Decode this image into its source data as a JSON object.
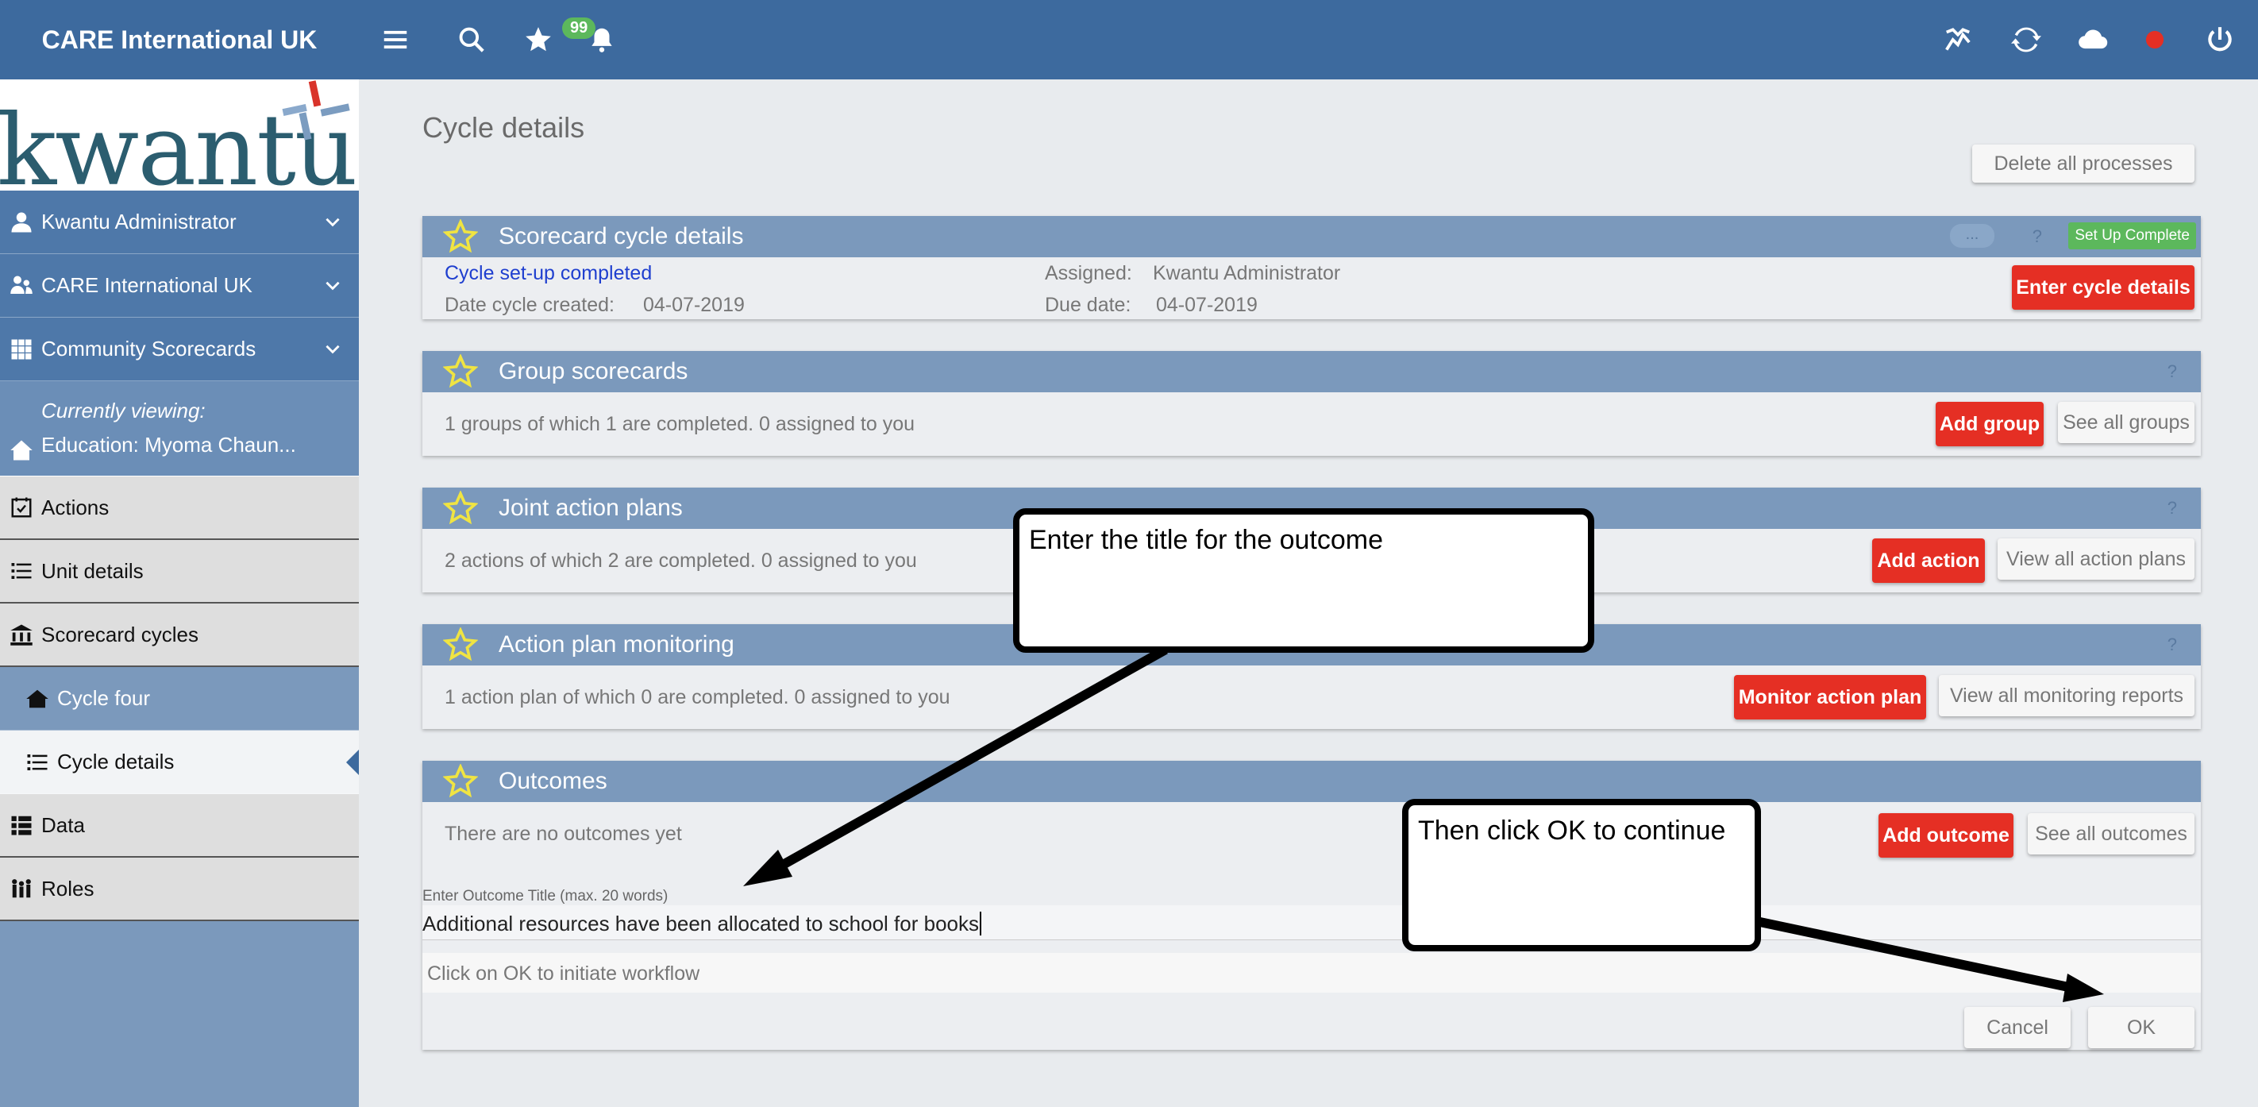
{
  "header": {
    "app_title": "CARE International UK",
    "notification_count": "99",
    "icons": [
      "menu-icon",
      "search-icon",
      "star-icon",
      "bell-icon",
      "chart-icon",
      "sync-icon",
      "cloud-icon",
      "record-icon",
      "power-icon"
    ]
  },
  "sidebar": {
    "logo_text": "kwantu",
    "items": [
      {
        "label": "Kwantu Administrator",
        "icon": "user-icon"
      },
      {
        "label": "CARE International UK",
        "icon": "org-icon"
      },
      {
        "label": "Community Scorecards",
        "icon": "grid-icon"
      }
    ],
    "viewing_label": "Currently viewing:",
    "viewing_value": "Education: Myoma Chaun...",
    "nav": [
      {
        "label": "Actions",
        "icon": "calendar-check-icon"
      },
      {
        "label": "Unit details",
        "icon": "list-icon"
      },
      {
        "label": "Scorecard cycles",
        "icon": "building-icon"
      },
      {
        "label": "Cycle four",
        "icon": "building-icon"
      },
      {
        "label": "Cycle details",
        "icon": "list-icon"
      },
      {
        "label": "Data",
        "icon": "list-icon"
      },
      {
        "label": "Roles",
        "icon": "people-icon"
      }
    ]
  },
  "main": {
    "page_title": "Cycle details",
    "delete_all_label": "Delete all processes",
    "scorecard": {
      "title": "Scorecard cycle details",
      "more": "...",
      "help": "?",
      "status_badge": "Set Up Complete",
      "status_link": "Cycle set-up completed",
      "date_label": "Date cycle created:",
      "date_value": "04-07-2019",
      "assigned_label": "Assigned:",
      "assigned_value": "Kwantu Administrator",
      "due_label": "Due date:",
      "due_value": "04-07-2019",
      "action_label": "Enter cycle details"
    },
    "group": {
      "title": "Group scorecards",
      "help": "?",
      "summary": "1 groups of which 1 are completed. 0 assigned to you",
      "add_label": "Add group",
      "see_label": "See all groups"
    },
    "joint": {
      "title": "Joint action plans",
      "help": "?",
      "summary": "2 actions of which 2 are completed. 0 assigned to you",
      "add_label": "Add action",
      "see_label": "View all action plans"
    },
    "monitoring": {
      "title": "Action plan monitoring",
      "help": "?",
      "summary": "1 action plan of which 0 are completed. 0 assigned to you",
      "add_label": "Monitor action plan",
      "see_label": "View all monitoring reports"
    },
    "outcomes": {
      "title": "Outcomes",
      "summary": "There are no outcomes yet",
      "add_label": "Add outcome",
      "see_label": "See all outcomes",
      "field_label": "Enter Outcome Title (max. 20 words)",
      "field_value": "Additional resources have been allocated to school for books",
      "hint": "Click on OK to initiate workflow",
      "cancel_label": "Cancel",
      "ok_label": "OK"
    }
  },
  "annotations": {
    "callout1": "Enter the title for the outcome",
    "callout2": "Then click OK to continue"
  },
  "colors": {
    "header": "#3d6a9e",
    "panel_head": "#7b99bc",
    "action_red": "#e52f24",
    "badge_green": "#5cb85c",
    "star_yellow": "#f0e442"
  }
}
